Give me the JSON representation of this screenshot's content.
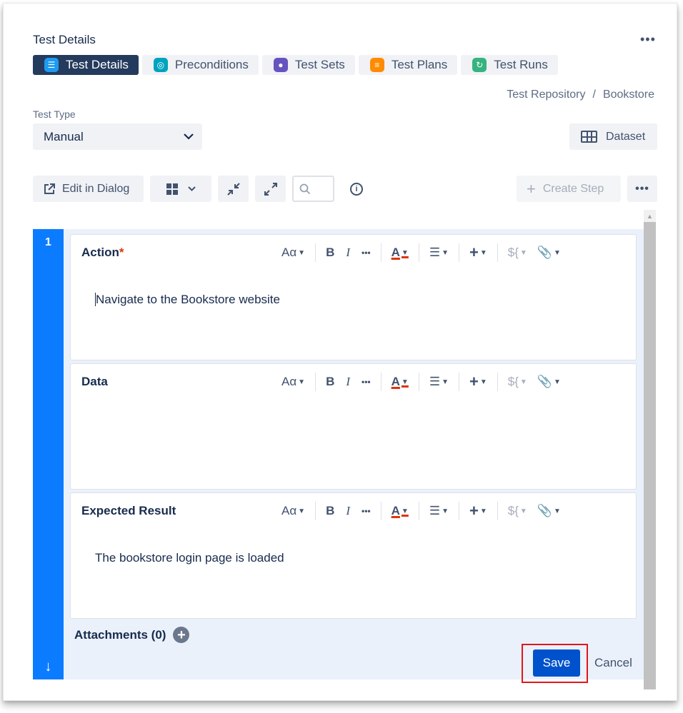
{
  "header": {
    "title": "Test Details",
    "more_label": "•••"
  },
  "tabs": [
    {
      "label": "Test Details",
      "icon": "list-icon",
      "color": "#1d9bf0",
      "active": true
    },
    {
      "label": "Preconditions",
      "icon": "precondition-icon",
      "color": "#00a3bf",
      "active": false
    },
    {
      "label": "Test Sets",
      "icon": "test-sets-icon",
      "color": "#6554c0",
      "active": false
    },
    {
      "label": "Test Plans",
      "icon": "test-plans-icon",
      "color": "#ff8b00",
      "active": false
    },
    {
      "label": "Test Runs",
      "icon": "test-runs-icon",
      "color": "#36b37e",
      "active": false
    }
  ],
  "breadcrumb": {
    "parent": "Test Repository",
    "separator": "/",
    "current": "Bookstore"
  },
  "test_type": {
    "label": "Test Type",
    "value": "Manual"
  },
  "dataset_button": {
    "label": "Dataset"
  },
  "toolbar": {
    "edit_in_dialog_label": "Edit in Dialog",
    "create_step_label": "Create Step",
    "more_label": "•••"
  },
  "step": {
    "number": "1",
    "fields": [
      {
        "label": "Action",
        "required_mark": "*",
        "value": "Navigate to the Bookstore website"
      },
      {
        "label": "Data",
        "required_mark": "",
        "value": ""
      },
      {
        "label": "Expected Result",
        "required_mark": "",
        "value": "The bookstore login page is loaded"
      }
    ],
    "editor_toolbar": {
      "text_style": "Aα",
      "bold": "B",
      "italic": "I",
      "more": "•••",
      "color": "A",
      "list": "☰",
      "insert": "+",
      "variable": "${"
    },
    "attachments_label": "Attachments (0)"
  },
  "actions": {
    "save_label": "Save",
    "cancel_label": "Cancel"
  },
  "colors": {
    "accent": "#0052cc",
    "step_bar": "#0b7cff",
    "active_tab": "#243b5e",
    "highlight": "#e2151c"
  }
}
